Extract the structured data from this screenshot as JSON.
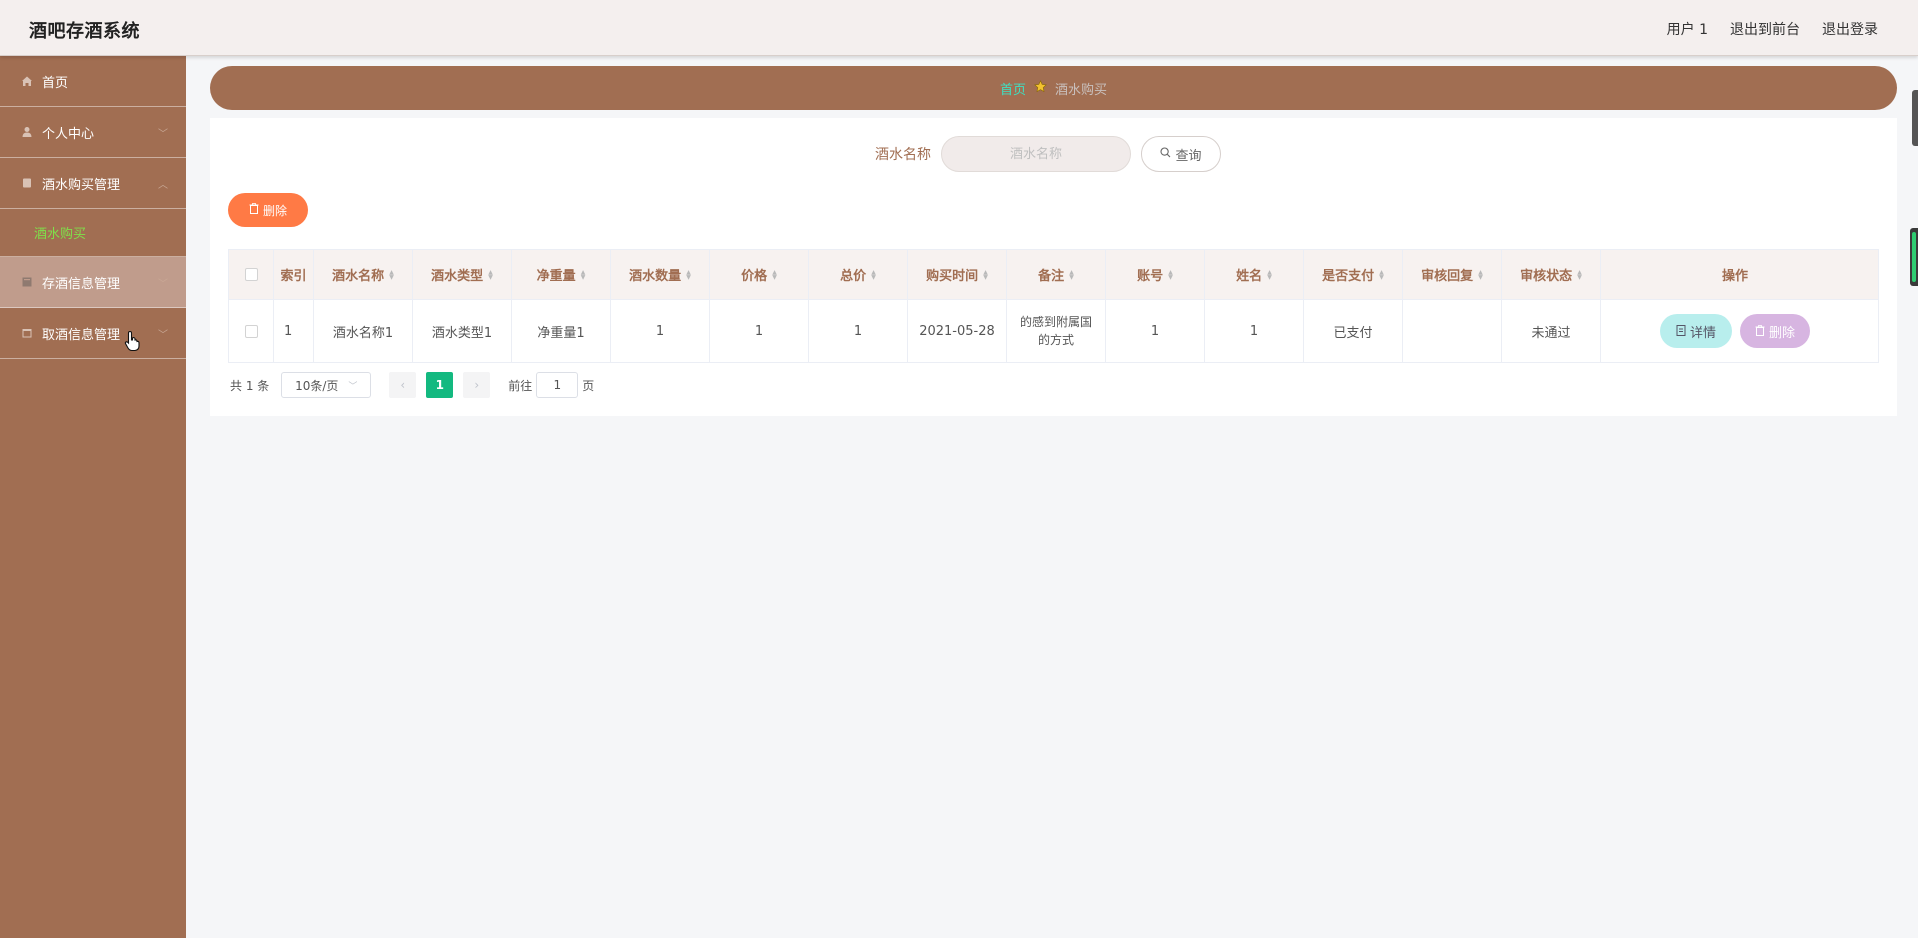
{
  "header": {
    "title": "酒吧存酒系统",
    "user": "用户 1",
    "back_to_front": "退出到前台",
    "logout": "退出登录"
  },
  "sidebar": {
    "items": [
      {
        "label": "首页",
        "icon": "home-icon"
      },
      {
        "label": "个人中心",
        "icon": "user-icon"
      },
      {
        "label": "酒水购买管理",
        "icon": "document-icon"
      },
      {
        "label": "存酒信息管理",
        "icon": "book-icon"
      },
      {
        "label": "取酒信息管理",
        "icon": "calendar-icon"
      }
    ],
    "sub_item": "酒水购买"
  },
  "breadcrumb": {
    "home": "首页",
    "current": "酒水购买"
  },
  "search": {
    "label": "酒水名称",
    "placeholder": "酒水名称",
    "button": "查询"
  },
  "toolbar": {
    "delete_label": "删除"
  },
  "table": {
    "headers": [
      "索引",
      "酒水名称",
      "酒水类型",
      "净重量",
      "酒水数量",
      "价格",
      "总价",
      "购买时间",
      "备注",
      "账号",
      "姓名",
      "是否支付",
      "审核回复",
      "审核状态",
      "操作"
    ],
    "rows": [
      {
        "index": "1",
        "name": "酒水名称1",
        "type": "酒水类型1",
        "weight": "净重量1",
        "quantity": "1",
        "price": "1",
        "total": "1",
        "time": "2021-05-28",
        "note": "的感到附属国的方式",
        "account": "1",
        "username": "1",
        "paid": "已支付",
        "reply": "",
        "status": "未通过",
        "detail_label": "详情",
        "delete_label": "删除"
      }
    ]
  },
  "pagination": {
    "total": "共 1 条",
    "page_size": "10条/页",
    "current_page": "1",
    "goto_prefix": "前往",
    "goto_value": "1",
    "goto_suffix": "页"
  },
  "colors": {
    "sidebar_bg": "#a16e52",
    "accent_green": "#13b980",
    "delete_orange": "#ff7a45"
  }
}
